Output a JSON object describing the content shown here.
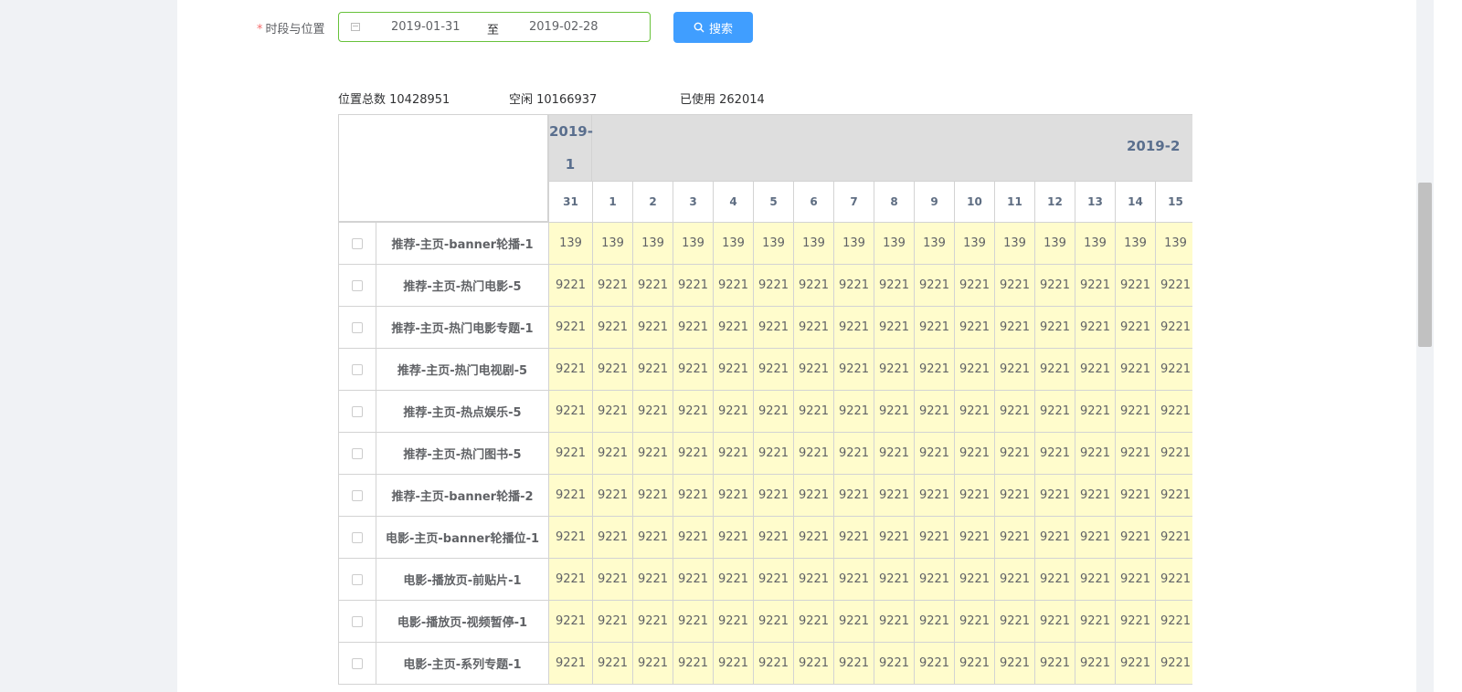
{
  "filter": {
    "label": "时段与位置",
    "required_mark": "*",
    "start_date": "2019-01-31",
    "separator": "至",
    "end_date": "2019-02-28",
    "search_label": "搜索"
  },
  "stats": {
    "total": "位置总数 10428951",
    "free": "空闲 10166937",
    "used": "已使用 262014"
  },
  "table": {
    "months": [
      "2019-1",
      "2019-2"
    ],
    "days": [
      "31",
      "1",
      "2",
      "3",
      "4",
      "5",
      "6",
      "7",
      "8",
      "9",
      "10",
      "11",
      "12",
      "13",
      "14",
      "15"
    ],
    "rows": [
      {
        "name": "推荐-主页-banner轮播-1",
        "value": "139"
      },
      {
        "name": "推荐-主页-热门电影-5",
        "value": "9221"
      },
      {
        "name": "推荐-主页-热门电影专题-1",
        "value": "9221"
      },
      {
        "name": "推荐-主页-热门电视剧-5",
        "value": "9221"
      },
      {
        "name": "推荐-主页-热点娱乐-5",
        "value": "9221"
      },
      {
        "name": "推荐-主页-热门图书-5",
        "value": "9221"
      },
      {
        "name": "推荐-主页-banner轮播-2",
        "value": "9221"
      },
      {
        "name": "电影-主页-banner轮播位-1",
        "value": "9221"
      },
      {
        "name": "电影-播放页-前贴片-1",
        "value": "9221"
      },
      {
        "name": "电影-播放页-视频暂停-1",
        "value": "9221"
      },
      {
        "name": "电影-主页-系列专题-1",
        "value": "9221"
      }
    ]
  },
  "colors": {
    "accent": "#409eff",
    "input_border": "#67c23a",
    "cell_bg": "#fffccc",
    "header_bg": "#dedede",
    "sidebar_bg": "#f0f2f5"
  }
}
